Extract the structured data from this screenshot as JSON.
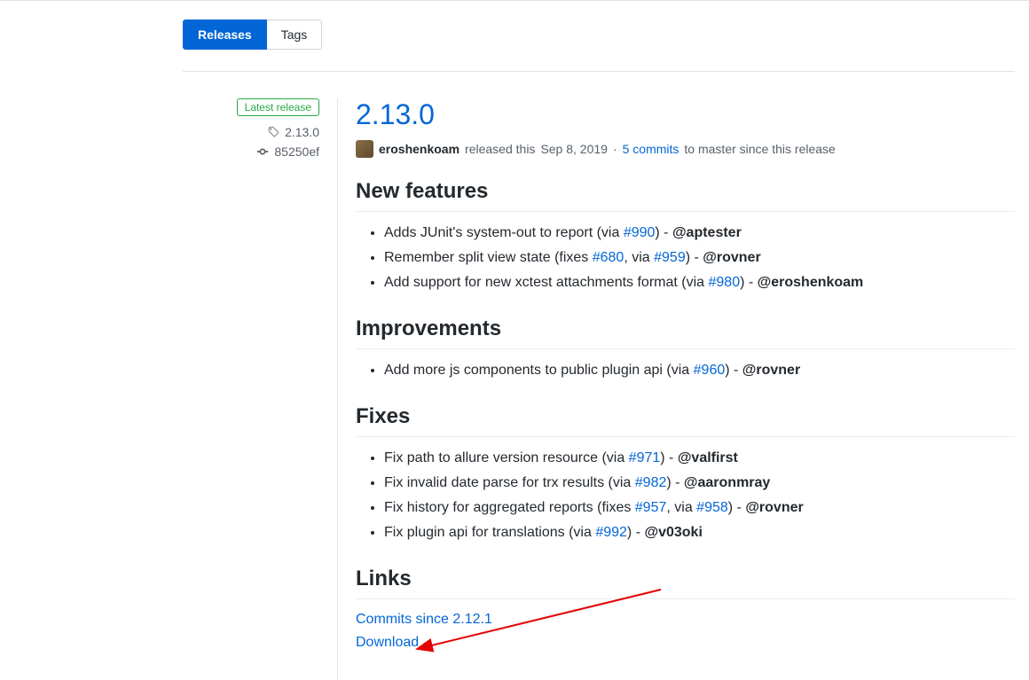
{
  "tabs": {
    "releases": "Releases",
    "tags": "Tags"
  },
  "sidebar": {
    "latest_badge": "Latest release",
    "tag": "2.13.0",
    "commit": "85250ef"
  },
  "release": {
    "title": "2.13.0",
    "author": "eroshenkoam",
    "released_prefix": "released this",
    "date": "Sep 8, 2019",
    "dot": "·",
    "commits_link": "5 commits",
    "commits_suffix": "to master since this release"
  },
  "sections": {
    "new_features": {
      "heading": "New features",
      "items": [
        {
          "prefix": "Adds JUnit's system-out to report (via ",
          "link1": "#990",
          "mid": ") - ",
          "author": "@aptester"
        },
        {
          "prefix": "Remember split view state (fixes ",
          "link1": "#680",
          "mid1": ", via ",
          "link2": "#959",
          "mid2": ") - ",
          "author": "@rovner"
        },
        {
          "prefix": "Add support for new xctest attachments format (via ",
          "link1": "#980",
          "mid": ") - ",
          "author": "@eroshenkoam"
        }
      ]
    },
    "improvements": {
      "heading": "Improvements",
      "items": [
        {
          "prefix": "Add more js components to public plugin api (via ",
          "link1": "#960",
          "mid": ") - ",
          "author": "@rovner"
        }
      ]
    },
    "fixes": {
      "heading": "Fixes",
      "items": [
        {
          "prefix": "Fix path to allure version resource (via ",
          "link1": "#971",
          "mid": ") - ",
          "author": "@valfirst"
        },
        {
          "prefix": "Fix invalid date parse for trx results (via ",
          "link1": "#982",
          "mid": ") - ",
          "author": "@aaronmray"
        },
        {
          "prefix": "Fix history for aggregated reports (fixes ",
          "link1": "#957",
          "mid1": ", via ",
          "link2": "#958",
          "mid2": ") - ",
          "author": "@rovner"
        },
        {
          "prefix": "Fix plugin api for translations (via ",
          "link1": "#992",
          "mid": ") - ",
          "author": "@v03oki"
        }
      ]
    },
    "links": {
      "heading": "Links",
      "commits_since": "Commits since 2.12.1",
      "download": "Download"
    }
  }
}
